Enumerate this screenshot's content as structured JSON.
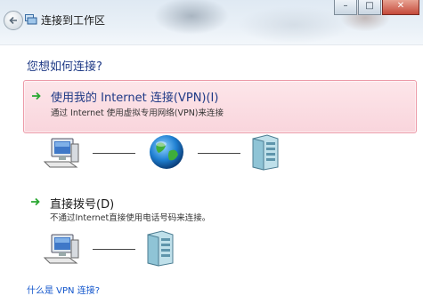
{
  "window": {
    "title": "连接到工作区",
    "buttons": {
      "minimize": "–",
      "maximize": "□",
      "close": "✕"
    }
  },
  "main": {
    "question": "您想如何连接?",
    "options": [
      {
        "title": "使用我的 Internet 连接(VPN)(I)",
        "description": "通过 Internet 使用虚拟专用网络(VPN)来连接",
        "selected": true
      },
      {
        "title": "直接拨号(D)",
        "description": "不通过Internet直接使用电话号码来连接。",
        "selected": false
      }
    ],
    "help_link": "什么是 VPN 连接?"
  },
  "icons": {
    "back": "back-arrow-icon",
    "app": "network-icon",
    "option_arrow": "green-arrow-icon",
    "computer": "computer-icon",
    "internet": "globe-icon",
    "server": "server-icon"
  },
  "colors": {
    "highlight_bg": "#f9d5dc",
    "highlight_border": "#ec9aa8",
    "heading": "#1f3a86",
    "link": "#1155cc",
    "arrow": "#2aa832"
  }
}
